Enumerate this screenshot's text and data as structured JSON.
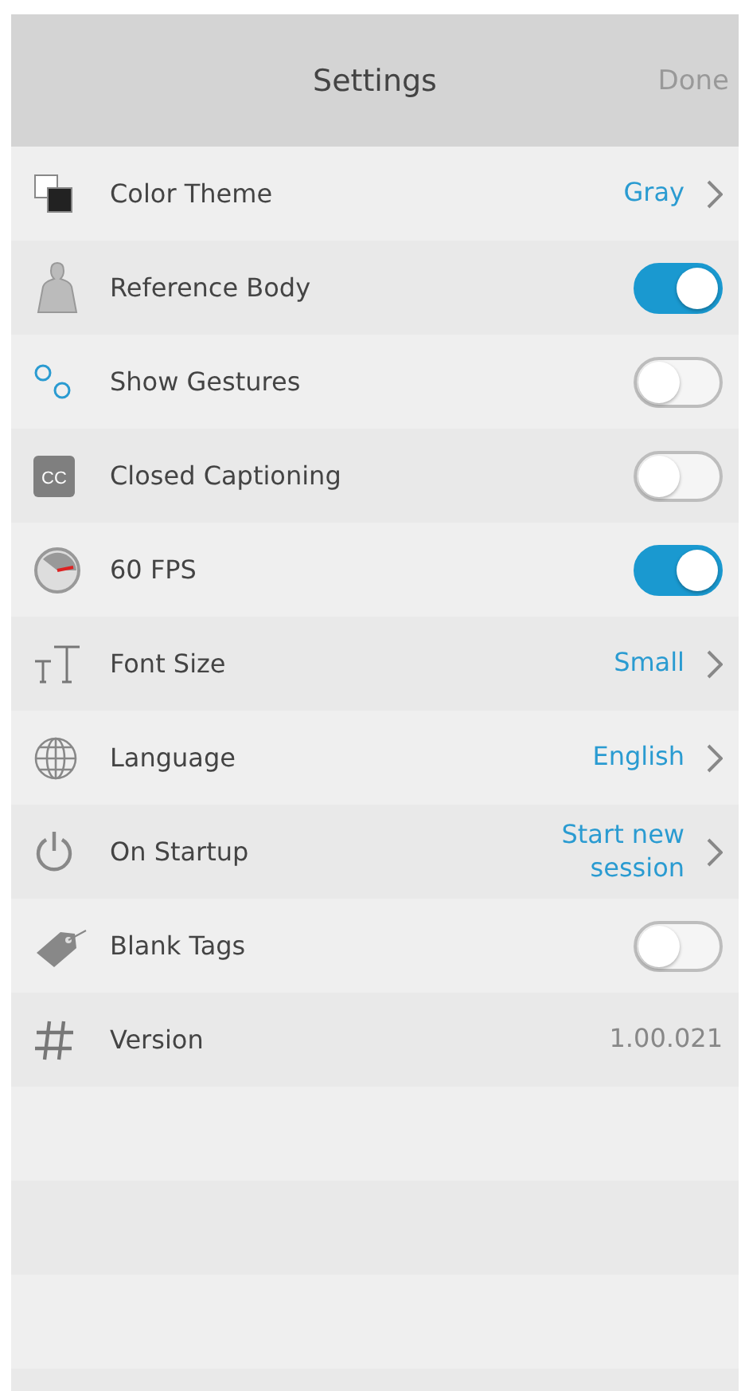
{
  "header": {
    "title": "Settings",
    "done": "Done"
  },
  "rows": [
    {
      "kind": "link",
      "label": "Color Theme",
      "value": "Gray"
    },
    {
      "kind": "toggle",
      "label": "Reference Body",
      "on": true
    },
    {
      "kind": "toggle",
      "label": "Show Gestures",
      "on": false
    },
    {
      "kind": "toggle",
      "label": "Closed Captioning",
      "on": false,
      "icon_text": "CC"
    },
    {
      "kind": "toggle",
      "label": "60 FPS",
      "on": true
    },
    {
      "kind": "link",
      "label": "Font Size",
      "value": "Small"
    },
    {
      "kind": "link",
      "label": "Language",
      "value": "English"
    },
    {
      "kind": "link",
      "label": "On Startup",
      "value": "Start new session"
    },
    {
      "kind": "toggle",
      "label": "Blank Tags",
      "on": false
    },
    {
      "kind": "info",
      "label": "Version",
      "value": "1.00.021"
    }
  ]
}
